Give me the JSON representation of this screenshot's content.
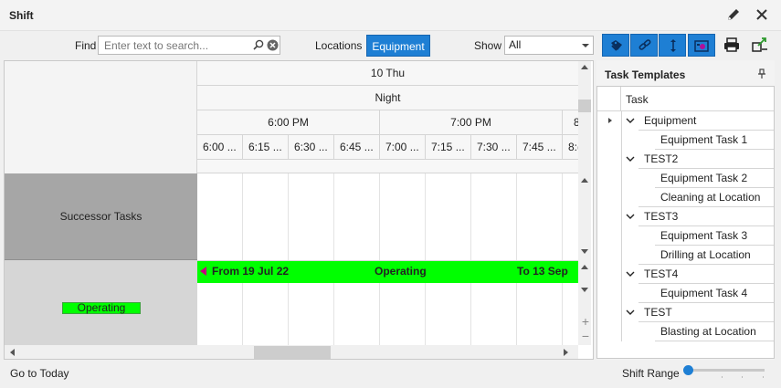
{
  "window": {
    "title": "Shift"
  },
  "toolbar": {
    "find_label": "Find",
    "find_placeholder": "Enter text to search...",
    "locations_label": "Locations",
    "equipment_label": "Equipment",
    "show_label": "Show",
    "show_value": "All"
  },
  "timeline": {
    "day": "10 Thu",
    "shift": "Night",
    "hours": [
      "6:00 PM",
      "7:00 PM",
      "8"
    ],
    "quarters": [
      "6:00 ...",
      "6:15 ...",
      "6:30 ...",
      "6:45 ...",
      "7:00 ...",
      "7:15 ...",
      "7:30 ...",
      "7:45 ...",
      "8:("
    ]
  },
  "resources": {
    "successor": "Successor Tasks",
    "operating": "Operating"
  },
  "task_bar": {
    "from": "From 19 Jul 22",
    "label": "Operating",
    "to": "To 13 Sep",
    "color": "#00ff00"
  },
  "task_templates": {
    "title": "Task Templates",
    "column": "Task",
    "groups": [
      {
        "name": "Equipment",
        "items": [
          "Equipment Task 1"
        ]
      },
      {
        "name": "TEST2",
        "items": [
          "Equipment Task 2",
          "Cleaning at Location"
        ]
      },
      {
        "name": "TEST3",
        "items": [
          "Equipment Task 3",
          "Drilling at Location"
        ]
      },
      {
        "name": "TEST4",
        "items": [
          "Equipment Task 4"
        ]
      },
      {
        "name": "TEST",
        "items": [
          "Blasting at Location"
        ]
      }
    ]
  },
  "status": {
    "goto_today": "Go to Today",
    "shift_range": "Shift Range"
  },
  "colors": {
    "accent": "#1e7fd4",
    "operating": "#00ff00",
    "successor_bg": "#a6a6a6"
  }
}
